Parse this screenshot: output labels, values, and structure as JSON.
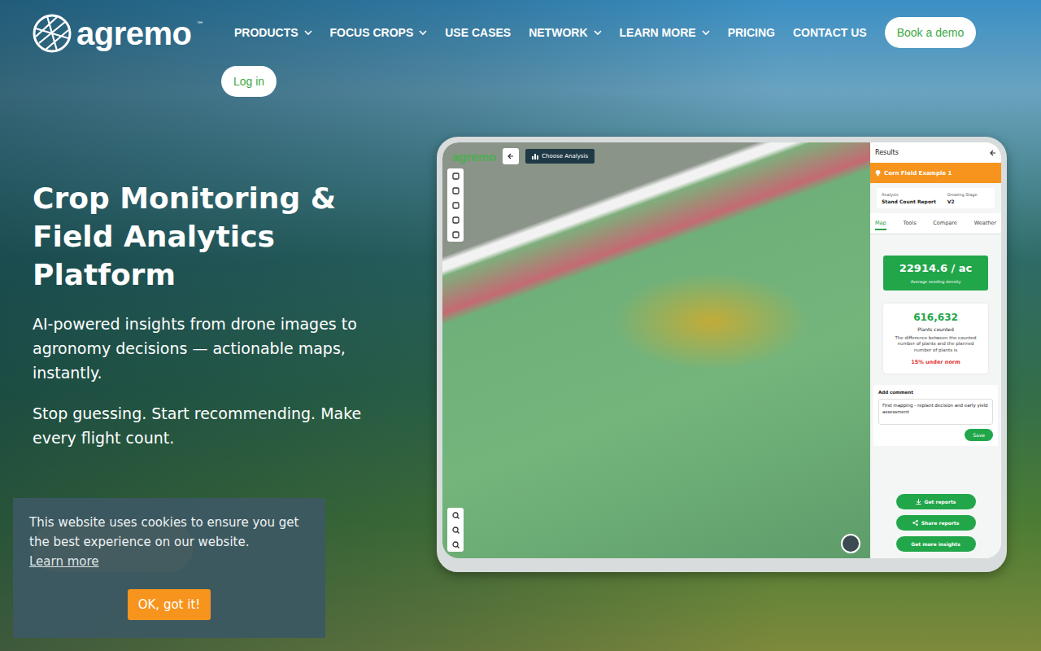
{
  "logo": {
    "text": "agremo",
    "mark": "™"
  },
  "nav": {
    "items": [
      {
        "label": "PRODUCTS",
        "has_menu": true
      },
      {
        "label": "FOCUS CROPS",
        "has_menu": true
      },
      {
        "label": "USE CASES",
        "has_menu": false
      },
      {
        "label": "NETWORK",
        "has_menu": true
      },
      {
        "label": "LEARN MORE",
        "has_menu": true
      },
      {
        "label": "PRICING",
        "has_menu": false
      },
      {
        "label": "CONTACT US",
        "has_menu": false
      }
    ],
    "book_demo": "Book a demo",
    "login": "Log in"
  },
  "hero": {
    "title": "Crop Monitoring & Field Analytics Platform",
    "subtitle": "AI-powered insights from drone images to agronomy decisions — actionable maps, instantly.",
    "tagline": "Stop guessing. Start recommending. Make every flight count."
  },
  "app": {
    "logo": "agremo",
    "choose_analysis": "Choose Analysis",
    "results": {
      "title": "Results",
      "field": "Corn Field Example 1",
      "meta": [
        {
          "label": "Analysis",
          "value": "Stand Count Report"
        },
        {
          "label": "Growing Stage",
          "value": "V2"
        }
      ],
      "tabs": [
        {
          "label": "Map",
          "selected": true
        },
        {
          "label": "Tools",
          "selected": false
        },
        {
          "label": "Compare",
          "selected": false
        },
        {
          "label": "Weather",
          "selected": false
        }
      ],
      "density": {
        "value": "22914.6 / ac",
        "label": "Average seeding density"
      },
      "count": {
        "value": "616,632",
        "label": "Plants counted",
        "note": "The difference between the counted number of plants and the planned number of plants is",
        "delta": "15% under norm"
      },
      "comment": {
        "label": "Add comment",
        "text": "First mapping - replant decision and early yield assessment",
        "save": "Save"
      },
      "actions": [
        {
          "label": "Get reports",
          "kind": "download"
        },
        {
          "label": "Share reports",
          "kind": "share"
        },
        {
          "label": "Get more insights",
          "kind": "plain"
        }
      ]
    }
  },
  "cookie_banner": {
    "text": "This website uses cookies to ensure you get the best experience on our website.",
    "link": "Learn more",
    "button": "OK, got it!"
  }
}
